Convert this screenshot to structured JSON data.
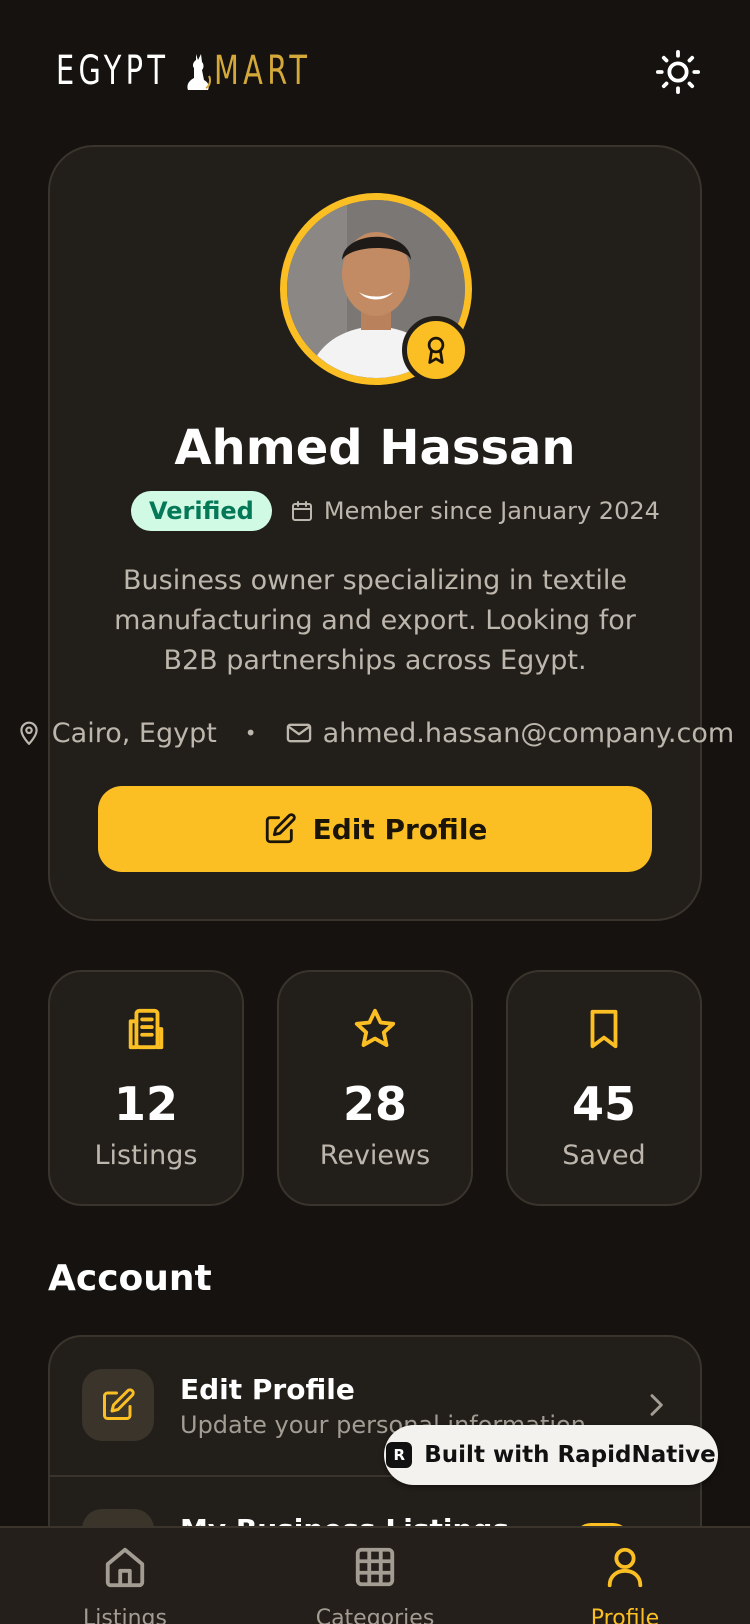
{
  "header": {
    "logo_left": "EGYPT",
    "logo_right": "MART",
    "theme_icon": "sun-icon"
  },
  "profile": {
    "name": "Ahmed Hassan",
    "verified_label": "Verified",
    "member_since": "Member since January 2024",
    "bio": "Business owner specializing in textile manufacturing and export. Looking for B2B partnerships across Egypt.",
    "location": "Cairo, Egypt",
    "separator": "•",
    "email": "ahmed.hassan@company.com",
    "edit_button_label": "Edit Profile"
  },
  "stats": [
    {
      "icon": "document-icon",
      "value": "12",
      "label": "Listings"
    },
    {
      "icon": "star-icon",
      "value": "28",
      "label": "Reviews"
    },
    {
      "icon": "bookmark-icon",
      "value": "45",
      "label": "Saved"
    }
  ],
  "account": {
    "title": "Account",
    "items": [
      {
        "icon": "edit-icon",
        "title": "Edit Profile",
        "subtitle": "Update your personal information"
      },
      {
        "icon": "document-icon",
        "title": "My Business Listings",
        "subtitle": ""
      }
    ]
  },
  "built_with": "Built with RapidNative",
  "nav": [
    {
      "icon": "home-icon",
      "label": "Listings",
      "active": false
    },
    {
      "icon": "grid-icon",
      "label": "Categories",
      "active": false
    },
    {
      "icon": "user-icon",
      "label": "Profile",
      "active": true
    }
  ],
  "colors": {
    "background": "#15120f",
    "card": "#221e1a",
    "accent": "#fbbf24",
    "muted_text": "#bdb6ac",
    "verified_bg": "#d1fae5",
    "verified_text": "#047857"
  }
}
